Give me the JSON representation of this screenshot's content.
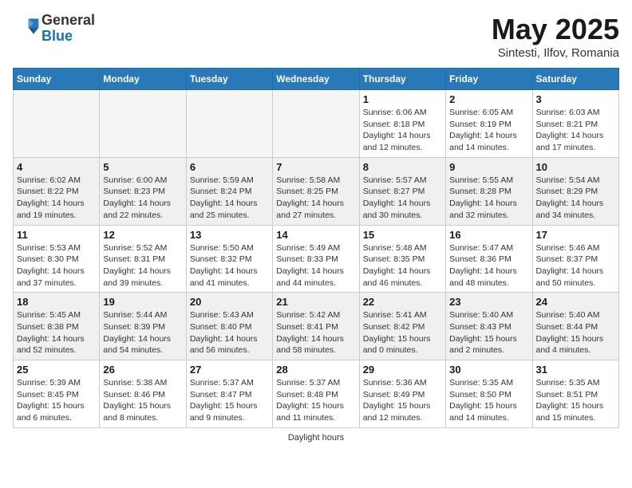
{
  "header": {
    "logo_general": "General",
    "logo_blue": "Blue",
    "month_title": "May 2025",
    "subtitle": "Sintesti, Ilfov, Romania"
  },
  "weekdays": [
    "Sunday",
    "Monday",
    "Tuesday",
    "Wednesday",
    "Thursday",
    "Friday",
    "Saturday"
  ],
  "weeks": [
    [
      {
        "day": "",
        "info": "",
        "empty": true
      },
      {
        "day": "",
        "info": "",
        "empty": true
      },
      {
        "day": "",
        "info": "",
        "empty": true
      },
      {
        "day": "",
        "info": "",
        "empty": true
      },
      {
        "day": "1",
        "info": "Sunrise: 6:06 AM\nSunset: 8:18 PM\nDaylight: 14 hours\nand 12 minutes.",
        "empty": false
      },
      {
        "day": "2",
        "info": "Sunrise: 6:05 AM\nSunset: 8:19 PM\nDaylight: 14 hours\nand 14 minutes.",
        "empty": false
      },
      {
        "day": "3",
        "info": "Sunrise: 6:03 AM\nSunset: 8:21 PM\nDaylight: 14 hours\nand 17 minutes.",
        "empty": false
      }
    ],
    [
      {
        "day": "4",
        "info": "Sunrise: 6:02 AM\nSunset: 8:22 PM\nDaylight: 14 hours\nand 19 minutes.",
        "empty": false
      },
      {
        "day": "5",
        "info": "Sunrise: 6:00 AM\nSunset: 8:23 PM\nDaylight: 14 hours\nand 22 minutes.",
        "empty": false
      },
      {
        "day": "6",
        "info": "Sunrise: 5:59 AM\nSunset: 8:24 PM\nDaylight: 14 hours\nand 25 minutes.",
        "empty": false
      },
      {
        "day": "7",
        "info": "Sunrise: 5:58 AM\nSunset: 8:25 PM\nDaylight: 14 hours\nand 27 minutes.",
        "empty": false
      },
      {
        "day": "8",
        "info": "Sunrise: 5:57 AM\nSunset: 8:27 PM\nDaylight: 14 hours\nand 30 minutes.",
        "empty": false
      },
      {
        "day": "9",
        "info": "Sunrise: 5:55 AM\nSunset: 8:28 PM\nDaylight: 14 hours\nand 32 minutes.",
        "empty": false
      },
      {
        "day": "10",
        "info": "Sunrise: 5:54 AM\nSunset: 8:29 PM\nDaylight: 14 hours\nand 34 minutes.",
        "empty": false
      }
    ],
    [
      {
        "day": "11",
        "info": "Sunrise: 5:53 AM\nSunset: 8:30 PM\nDaylight: 14 hours\nand 37 minutes.",
        "empty": false
      },
      {
        "day": "12",
        "info": "Sunrise: 5:52 AM\nSunset: 8:31 PM\nDaylight: 14 hours\nand 39 minutes.",
        "empty": false
      },
      {
        "day": "13",
        "info": "Sunrise: 5:50 AM\nSunset: 8:32 PM\nDaylight: 14 hours\nand 41 minutes.",
        "empty": false
      },
      {
        "day": "14",
        "info": "Sunrise: 5:49 AM\nSunset: 8:33 PM\nDaylight: 14 hours\nand 44 minutes.",
        "empty": false
      },
      {
        "day": "15",
        "info": "Sunrise: 5:48 AM\nSunset: 8:35 PM\nDaylight: 14 hours\nand 46 minutes.",
        "empty": false
      },
      {
        "day": "16",
        "info": "Sunrise: 5:47 AM\nSunset: 8:36 PM\nDaylight: 14 hours\nand 48 minutes.",
        "empty": false
      },
      {
        "day": "17",
        "info": "Sunrise: 5:46 AM\nSunset: 8:37 PM\nDaylight: 14 hours\nand 50 minutes.",
        "empty": false
      }
    ],
    [
      {
        "day": "18",
        "info": "Sunrise: 5:45 AM\nSunset: 8:38 PM\nDaylight: 14 hours\nand 52 minutes.",
        "empty": false
      },
      {
        "day": "19",
        "info": "Sunrise: 5:44 AM\nSunset: 8:39 PM\nDaylight: 14 hours\nand 54 minutes.",
        "empty": false
      },
      {
        "day": "20",
        "info": "Sunrise: 5:43 AM\nSunset: 8:40 PM\nDaylight: 14 hours\nand 56 minutes.",
        "empty": false
      },
      {
        "day": "21",
        "info": "Sunrise: 5:42 AM\nSunset: 8:41 PM\nDaylight: 14 hours\nand 58 minutes.",
        "empty": false
      },
      {
        "day": "22",
        "info": "Sunrise: 5:41 AM\nSunset: 8:42 PM\nDaylight: 15 hours\nand 0 minutes.",
        "empty": false
      },
      {
        "day": "23",
        "info": "Sunrise: 5:40 AM\nSunset: 8:43 PM\nDaylight: 15 hours\nand 2 minutes.",
        "empty": false
      },
      {
        "day": "24",
        "info": "Sunrise: 5:40 AM\nSunset: 8:44 PM\nDaylight: 15 hours\nand 4 minutes.",
        "empty": false
      }
    ],
    [
      {
        "day": "25",
        "info": "Sunrise: 5:39 AM\nSunset: 8:45 PM\nDaylight: 15 hours\nand 6 minutes.",
        "empty": false
      },
      {
        "day": "26",
        "info": "Sunrise: 5:38 AM\nSunset: 8:46 PM\nDaylight: 15 hours\nand 8 minutes.",
        "empty": false
      },
      {
        "day": "27",
        "info": "Sunrise: 5:37 AM\nSunset: 8:47 PM\nDaylight: 15 hours\nand 9 minutes.",
        "empty": false
      },
      {
        "day": "28",
        "info": "Sunrise: 5:37 AM\nSunset: 8:48 PM\nDaylight: 15 hours\nand 11 minutes.",
        "empty": false
      },
      {
        "day": "29",
        "info": "Sunrise: 5:36 AM\nSunset: 8:49 PM\nDaylight: 15 hours\nand 12 minutes.",
        "empty": false
      },
      {
        "day": "30",
        "info": "Sunrise: 5:35 AM\nSunset: 8:50 PM\nDaylight: 15 hours\nand 14 minutes.",
        "empty": false
      },
      {
        "day": "31",
        "info": "Sunrise: 5:35 AM\nSunset: 8:51 PM\nDaylight: 15 hours\nand 15 minutes.",
        "empty": false
      }
    ]
  ],
  "footer": "Daylight hours"
}
